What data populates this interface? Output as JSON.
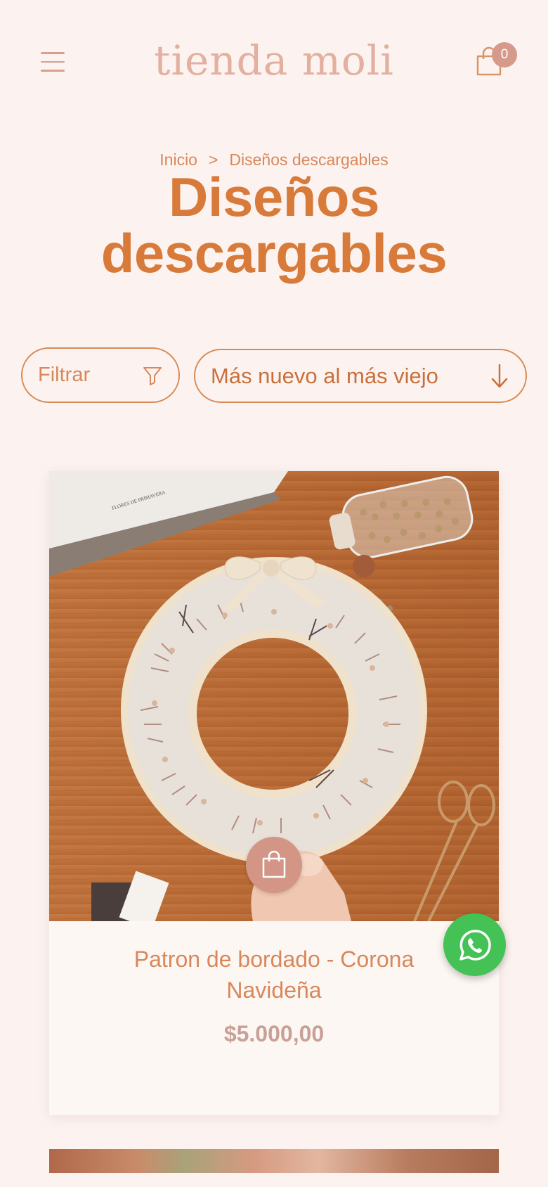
{
  "header": {
    "logo": "tienda moli",
    "cart_count": "0",
    "icons": {
      "menu": "hamburger-menu-icon",
      "cart": "shopping-bag-icon"
    }
  },
  "breadcrumb": {
    "home": "Inicio",
    "separator": ">",
    "current": "Diseños descargables"
  },
  "page": {
    "title_line1": "Diseños",
    "title_line2": "descargables"
  },
  "filters": {
    "filter_label": "Filtrar",
    "filter_icon": "funnel-icon",
    "sort_selected": "Más nuevo al más viejo",
    "sort_icon": "arrow-down-icon"
  },
  "products": [
    {
      "name": "Patron de bordado - Corona Navideña",
      "price": "$5.000,00",
      "image_book_text": "FLORES DE PRIMAVERA"
    }
  ],
  "colors": {
    "background": "#fcf3f0",
    "accent": "#d87a3a",
    "logo": "#e3b0a0",
    "price": "#c8a096",
    "whatsapp": "#44c255"
  }
}
